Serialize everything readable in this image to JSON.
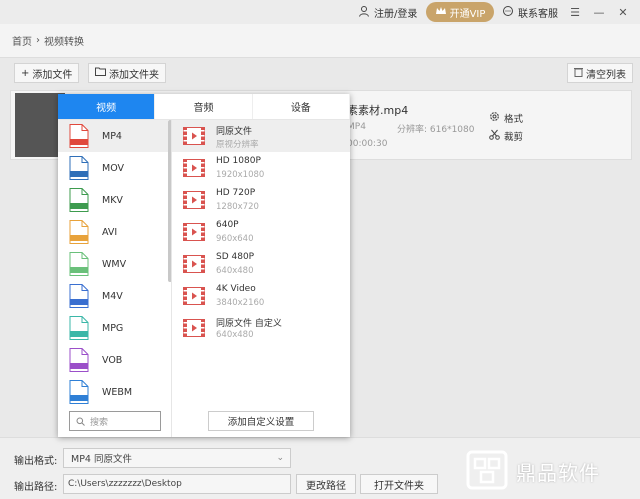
{
  "titlebar": {
    "login": "注册/登录",
    "vip": "开通VIP",
    "service": "联系客服"
  },
  "breadcrumb": {
    "home": "首页",
    "current": "视频转换"
  },
  "toolbar": {
    "add_file": "添加文件",
    "add_folder": "添加文件夹",
    "clear": "清空列表"
  },
  "file": {
    "name": "素素材.mp4",
    "format": "MP4",
    "resolution": "分辨率: 616*1080",
    "duration": "00:00:30",
    "action_format": "格式",
    "action_crop": "裁剪"
  },
  "popup": {
    "tabs": [
      "视频",
      "音频",
      "设备"
    ],
    "formats": [
      {
        "label": "MP4",
        "color": "#e0483c"
      },
      {
        "label": "MOV",
        "color": "#2f6fb8"
      },
      {
        "label": "MKV",
        "color": "#3d9b4e"
      },
      {
        "label": "AVI",
        "color": "#e8a23a"
      },
      {
        "label": "WMV",
        "color": "#6ac07a"
      },
      {
        "label": "M4V",
        "color": "#3a6fd0"
      },
      {
        "label": "MPG",
        "color": "#3bb7a8"
      },
      {
        "label": "VOB",
        "color": "#9b4fc9"
      },
      {
        "label": "WEBM",
        "color": "#2e7fd6"
      }
    ],
    "search_placeholder": "搜索",
    "resolutions": [
      {
        "name": "同原文件",
        "sub": "原视分辨率"
      },
      {
        "name": "HD 1080P",
        "sub": "1920x1080"
      },
      {
        "name": "HD 720P",
        "sub": "1280x720"
      },
      {
        "name": "640P",
        "sub": "960x640"
      },
      {
        "name": "SD 480P",
        "sub": "640x480"
      },
      {
        "name": "4K Video",
        "sub": "3840x2160"
      },
      {
        "name": "同原文件 自定义",
        "sub": "640x480"
      }
    ],
    "add_custom": "添加自定义设置"
  },
  "bottom": {
    "format_label": "输出格式:",
    "format_value": "MP4  同原文件",
    "path_label": "输出路径:",
    "path_value": "C:\\Users\\zzzzzzz\\Desktop",
    "change_path": "更改路径",
    "open_folder": "打开文件夹"
  },
  "watermark": {
    "text": "鼎品软件"
  },
  "colors": {
    "accent": "#1e86f0",
    "vip": "#c9a46a"
  }
}
